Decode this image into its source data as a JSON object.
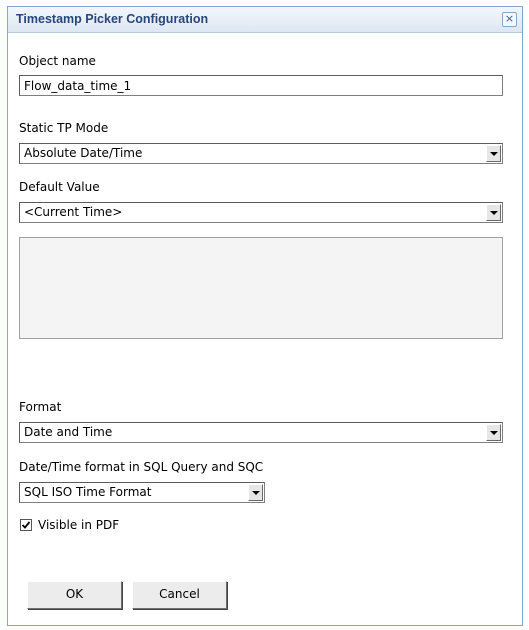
{
  "dialog": {
    "title": "Timestamp Picker Configuration",
    "close_glyph": "×",
    "close_icon": "close-icon"
  },
  "object_name": {
    "label": "Object name",
    "value": "Flow_data_time_1"
  },
  "static_tp_mode": {
    "label": "Static TP Mode",
    "selected": "Absolute Date/Time"
  },
  "default_value": {
    "label": "Default Value",
    "selected": "<Current Time>"
  },
  "format": {
    "label": "Format",
    "selected": "Date and Time"
  },
  "sql_format": {
    "label": "Date/Time format in SQL Query and SQC",
    "selected": "SQL ISO Time Format"
  },
  "visible_pdf": {
    "label": "Visible in PDF",
    "checked": true
  },
  "buttons": {
    "ok": "OK",
    "cancel": "Cancel"
  },
  "colors": {
    "title_text": "#28467a",
    "border": "#8aa4c8"
  }
}
